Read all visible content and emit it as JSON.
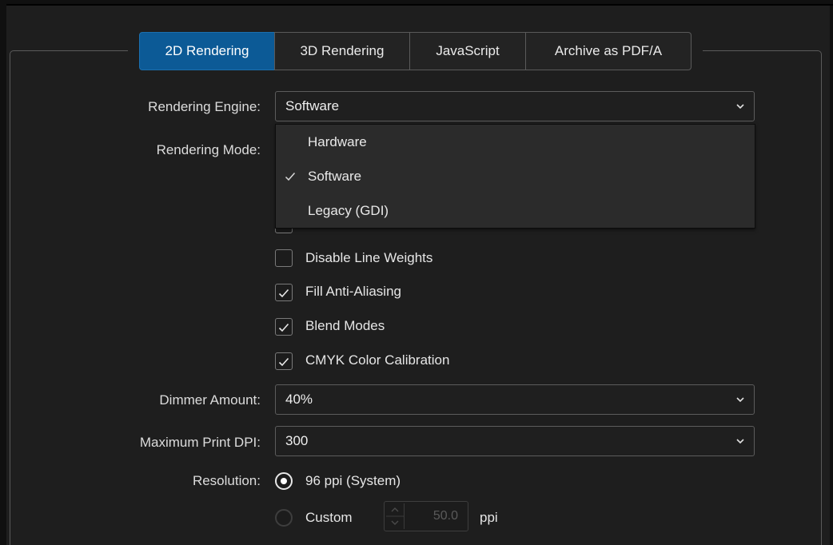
{
  "tabs": [
    {
      "label": "2D Rendering",
      "active": true
    },
    {
      "label": "3D Rendering",
      "active": false
    },
    {
      "label": "JavaScript",
      "active": false
    },
    {
      "label": "Archive as PDF/A",
      "active": false
    }
  ],
  "rendering_engine": {
    "label": "Rendering Engine:",
    "value": "Software",
    "options": [
      "Hardware",
      "Software",
      "Legacy (GDI)"
    ],
    "selected_option": "Software"
  },
  "rendering_mode": {
    "label": "Rendering Mode:"
  },
  "checkboxes": [
    {
      "label": "Disable Line Weights",
      "checked": false
    },
    {
      "label": "Fill Anti-Aliasing",
      "checked": true
    },
    {
      "label": "Blend Modes",
      "checked": true
    },
    {
      "label": "CMYK Color Calibration",
      "checked": true
    }
  ],
  "dimmer_amount": {
    "label": "Dimmer Amount:",
    "value": "40%"
  },
  "max_print_dpi": {
    "label": "Maximum Print DPI:",
    "value": "300"
  },
  "resolution": {
    "label": "Resolution:",
    "options": [
      {
        "label": "96 ppi (System)",
        "selected": true
      },
      {
        "label": "Custom",
        "selected": false
      }
    ],
    "custom_value": "50.0",
    "unit": "ppi"
  },
  "colors": {
    "accent": "#0c5a96",
    "background": "#1e1e1e",
    "dropdown_bg": "#2b2b2b"
  },
  "icons": {
    "chevron": "chevron-down-icon",
    "check": "check-icon",
    "spin": "spin-arrows-icon"
  }
}
